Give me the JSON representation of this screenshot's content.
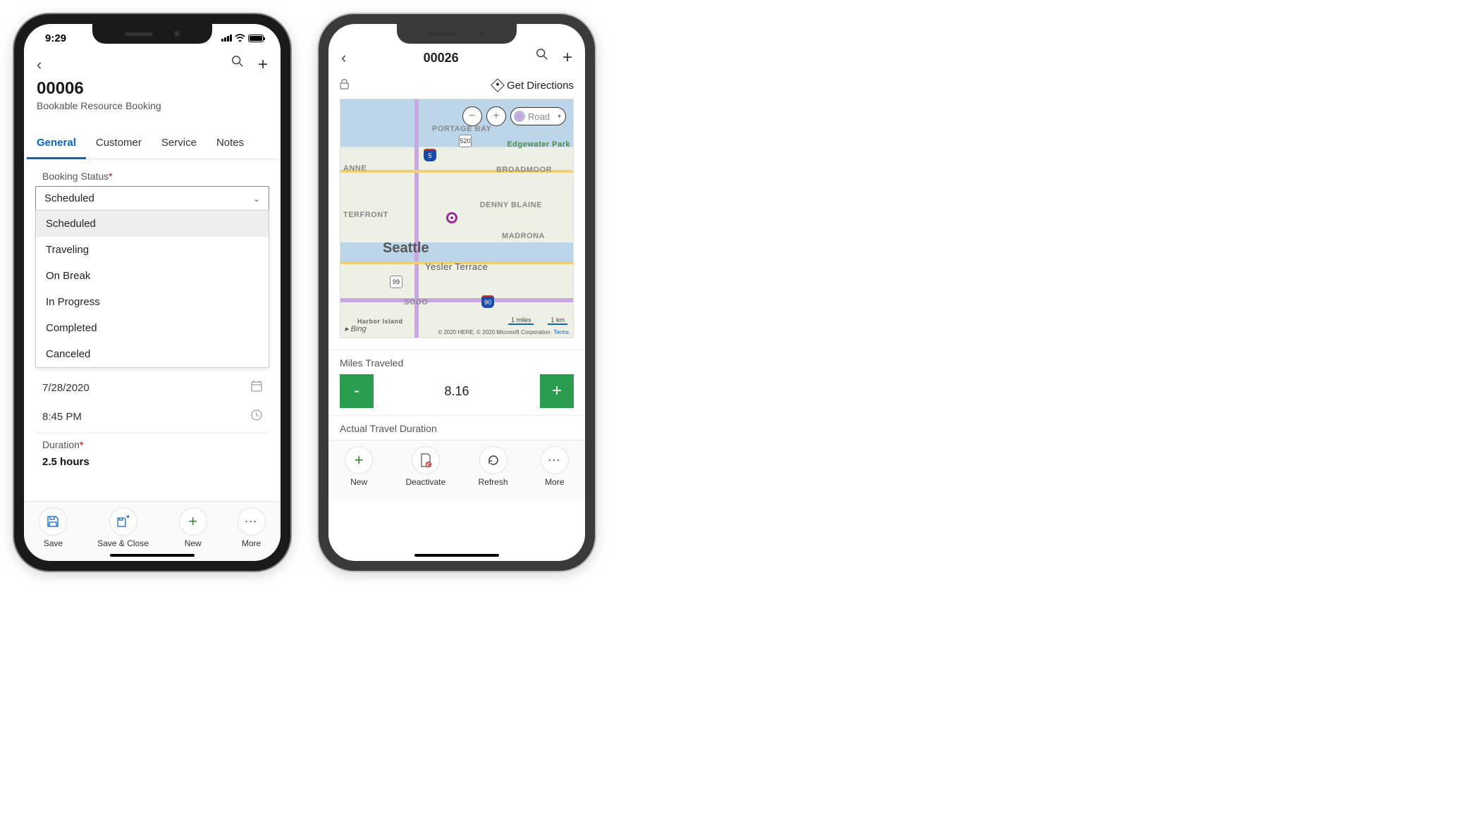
{
  "phone1": {
    "statusTime": "9:29",
    "header": {
      "title": "00006",
      "subtitle": "Bookable Resource Booking"
    },
    "tabs": [
      "General",
      "Customer",
      "Service",
      "Notes"
    ],
    "activeTab": "General",
    "bookingStatus": {
      "label": "Booking Status",
      "value": "Scheduled",
      "options": [
        "Scheduled",
        "Traveling",
        "On Break",
        "In Progress",
        "Completed",
        "Canceled"
      ]
    },
    "date": "7/28/2020",
    "time": "8:45 PM",
    "duration": {
      "label": "Duration",
      "value": "2.5 hours"
    },
    "bottom": {
      "save": "Save",
      "saveClose": "Save & Close",
      "new": "New",
      "more": "More"
    }
  },
  "phone2": {
    "header": {
      "title": "00026"
    },
    "getDirections": "Get Directions",
    "map": {
      "zoomType": "Road",
      "city": "Seattle",
      "labels": [
        "PORTAGE BAY",
        "Edgewater Park",
        "BROADMOOR",
        "DENNY BLAINE",
        "MADRONA",
        "Yesler Terrace",
        "SODO",
        "ANNE",
        "TERFRONT",
        "Harbor Island"
      ],
      "shields": [
        "5",
        "520",
        "99",
        "90"
      ],
      "scale": [
        "1 miles",
        "1 km"
      ],
      "attribution": "© 2020 HERE, © 2020 Microsoft Corporation",
      "terms": "Terms",
      "provider": "Bing"
    },
    "miles": {
      "label": "Miles Traveled",
      "value": "8.16"
    },
    "actualTravel": "Actual Travel Duration",
    "bottom": {
      "new": "New",
      "deactivate": "Deactivate",
      "refresh": "Refresh",
      "more": "More"
    }
  }
}
